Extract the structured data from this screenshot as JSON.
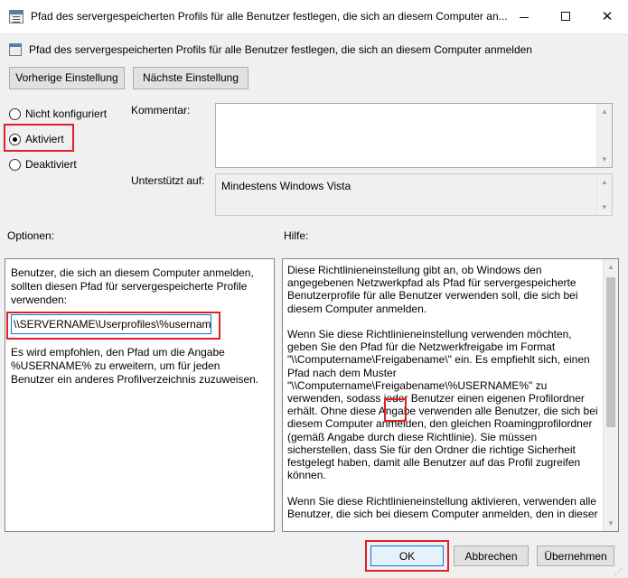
{
  "window": {
    "title": "Pfad des servergespeicherten Profils für alle Benutzer festlegen, die sich an diesem Computer an...",
    "minimize_glyph": "—",
    "close_glyph": "✕"
  },
  "header": {
    "title": "Pfad des servergespeicherten Profils für alle Benutzer festlegen, die sich an diesem Computer anmelden"
  },
  "nav": {
    "prev_label": "Vorherige Einstellung",
    "next_label": "Nächste Einstellung"
  },
  "state": {
    "not_configured": "Nicht konfiguriert",
    "enabled": "Aktiviert",
    "disabled": "Deaktiviert",
    "selected": "enabled"
  },
  "comment": {
    "label": "Kommentar:",
    "value": ""
  },
  "supported": {
    "label": "Unterstützt auf:",
    "value": "Mindestens Windows Vista"
  },
  "options": {
    "label": "Optionen:",
    "description": "Benutzer, die sich an diesem Computer anmelden, sollten diesen Pfad für servergespeicherte Profile verwenden:",
    "path_value": "\\\\SERVERNAME\\Userprofiles\\%username",
    "hint": "Es wird empfohlen, den Pfad um die Angabe %USERNAME% zu erweitern, um für jeden Benutzer ein anderes Profilverzeichnis zuzuweisen."
  },
  "help": {
    "label": "Hilfe:",
    "text": "Diese Richtlinieneinstellung gibt an, ob Windows den angegebenen Netzwerkpfad als Pfad für servergespeicherte Benutzerprofile für alle Benutzer verwenden soll, die sich bei diesem Computer anmelden.\n\nWenn Sie diese Richtlinieneinstellung verwenden möchten, geben Sie den Pfad für die Netzwerkfreigabe im Format \"\\\\Computername\\Freigabename\\\" ein. Es empfiehlt sich, einen Pfad nach dem Muster \"\\\\Computername\\Freigabename\\%USERNAME%\" zu verwenden, sodass jeder Benutzer einen eigenen Profilordner erhält. Ohne diese Angabe verwenden alle Benutzer, die sich bei diesem Computer anmelden, den gleichen Roamingprofilordner (gemäß Angabe durch diese Richtlinie). Sie müssen sicherstellen, dass Sie für den Ordner die richtige Sicherheit festgelegt haben, damit alle Benutzer auf das Profil zugreifen können.\n\nWenn Sie diese Richtlinieneinstellung aktivieren, verwenden alle Benutzer, die sich bei diesem Computer anmelden, den in dieser"
  },
  "footer": {
    "ok_label": "OK",
    "cancel_label": "Abbrechen",
    "apply_label": "Übernehmen"
  },
  "colors": {
    "highlight_red": "#e02027",
    "focus_blue": "#0078d7"
  }
}
